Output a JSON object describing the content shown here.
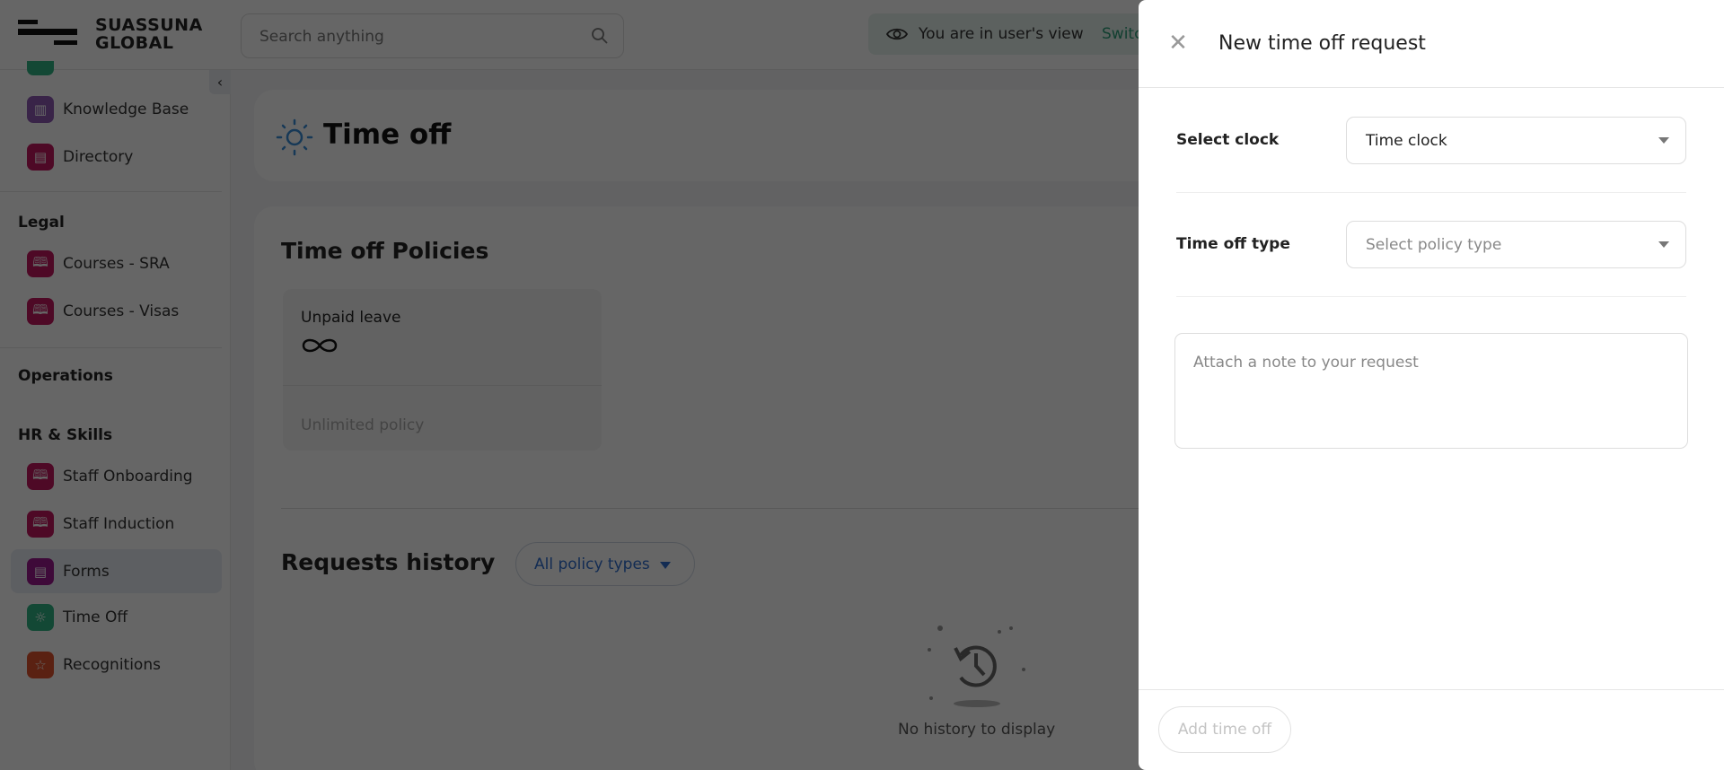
{
  "topbar": {
    "logo_text_line1": "SUASSUNA",
    "logo_text_line2": "GLOBAL",
    "search_placeholder": "Search anything",
    "banner_text": "You are in user's view",
    "banner_link": "Switc"
  },
  "sidebar": {
    "items_top": [
      {
        "label": "Knowledge Base",
        "icon": "book-icon",
        "color": "#8e5bb5"
      },
      {
        "label": "Directory",
        "icon": "directory-icon",
        "color": "#c3165f"
      }
    ],
    "sections": {
      "legal": "Legal",
      "operations": "Operations",
      "hr": "HR & Skills"
    },
    "legal_items": [
      {
        "label": "Courses - SRA",
        "icon": "book-icon",
        "color": "#c3165f"
      },
      {
        "label": "Courses - Visas",
        "icon": "book-icon",
        "color": "#c3165f"
      }
    ],
    "hr_items": [
      {
        "label": "Staff Onboarding",
        "icon": "book-icon",
        "color": "#c3165f"
      },
      {
        "label": "Staff Induction",
        "icon": "book-icon",
        "color": "#c3165f"
      },
      {
        "label": "Forms",
        "icon": "clipboard-icon",
        "color": "#9c1a8f"
      },
      {
        "label": "Time Off",
        "icon": "sun-icon",
        "color": "#2fb585"
      },
      {
        "label": "Recognitions",
        "icon": "star-icon",
        "color": "#e0532c"
      }
    ]
  },
  "main": {
    "title": "Time off",
    "policies_title": "Time off Policies",
    "policy": {
      "name": "Unpaid leave",
      "footer": "Unlimited policy"
    },
    "history_title": "Requests history",
    "filter_label": "All policy types",
    "empty_text": "No history to display"
  },
  "panel": {
    "title": "New time off request",
    "select_clock_label": "Select clock",
    "select_clock_value": "Time clock",
    "type_label": "Time off type",
    "type_placeholder": "Select policy type",
    "note_placeholder": "Attach a note to your request",
    "submit_label": "Add time off"
  }
}
